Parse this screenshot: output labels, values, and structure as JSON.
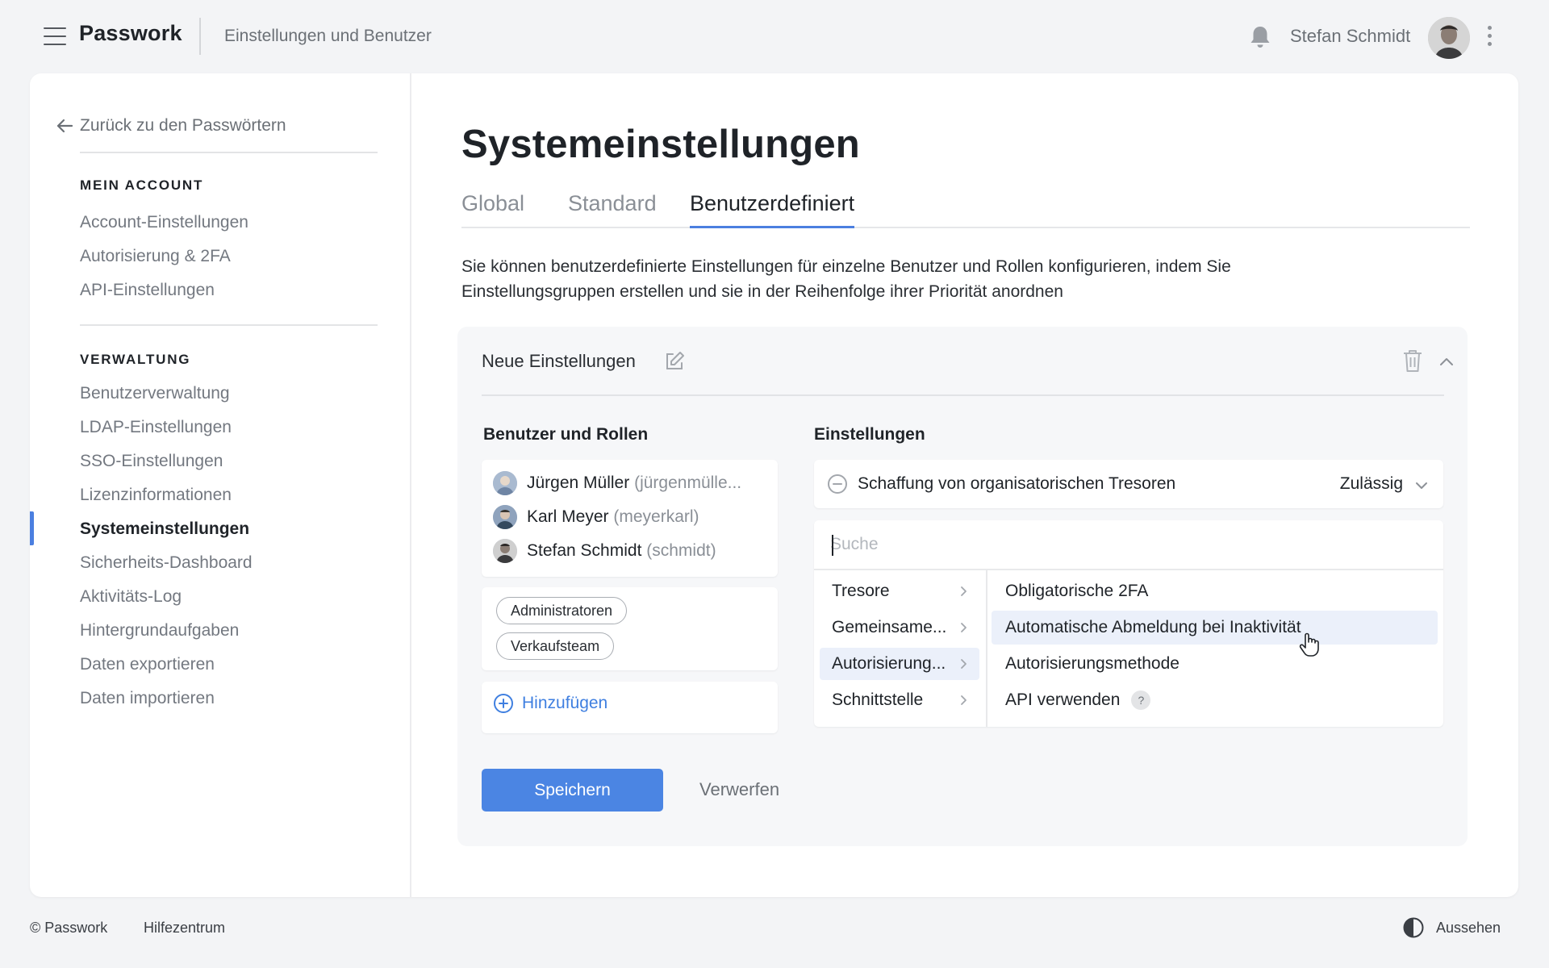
{
  "topbar": {
    "brand": "Passwork",
    "subtitle": "Einstellungen und Benutzer",
    "username": "Stefan Schmidt"
  },
  "sidebar": {
    "back_label": "Zurück zu den Passwörtern",
    "section_account": "MEIN ACCOUNT",
    "account_items": [
      "Account-Einstellungen",
      "Autorisierung & 2FA",
      "API-Einstellungen"
    ],
    "section_admin": "VERWALTUNG",
    "admin_items": [
      "Benutzerverwaltung",
      "LDAP-Einstellungen",
      "SSO-Einstellungen",
      "Lizenzinformationen",
      "Systemeinstellungen",
      "Sicherheits-Dashboard",
      "Aktivitäts-Log",
      "Hintergrundaufgaben",
      "Daten exportieren",
      "Daten importieren"
    ],
    "active_item": "Systemeinstellungen"
  },
  "main": {
    "title": "Systemeinstellungen",
    "tabs": [
      "Global",
      "Standard",
      "Benutzerdefiniert"
    ],
    "active_tab": "Benutzerdefiniert",
    "description": "Sie können benutzerdefinierte Einstellungen für einzelne Benutzer und Rollen konfigurieren, indem Sie Einstellungsgruppen erstellen und sie in der Reihenfolge ihrer Priorität anordnen"
  },
  "panel": {
    "name": "Neue Einstellungen",
    "users_label": "Benutzer und Rollen",
    "users": [
      {
        "name": "Jürgen Müller",
        "login": "(jürgenmülle..."
      },
      {
        "name": "Karl Meyer",
        "login": "(meyerkarl)"
      },
      {
        "name": "Stefan Schmidt",
        "login": "(schmidt)"
      }
    ],
    "roles": [
      "Administratoren",
      "Verkaufsteam"
    ],
    "add_label": "Hinzufügen",
    "settings_label": "Einstellungen",
    "setting": {
      "label": "Schaffung von organisatorischen Tresoren",
      "value": "Zulässig"
    },
    "search_placeholder": "Suche",
    "categories": [
      "Tresore",
      "Gemeinsame...",
      "Autorisierung...",
      "Schnittstelle"
    ],
    "active_category": "Autorisierung...",
    "options": [
      "Obligatorische 2FA",
      "Automatische Abmeldung bei Inaktivität",
      "Autorisierungsmethode",
      "API verwenden"
    ],
    "hovered_option": "Automatische Abmeldung bei Inaktivität",
    "help_badge": "?",
    "save_label": "Speichern",
    "discard_label": "Verwerfen"
  },
  "footer": {
    "copyright": "© Passwork",
    "help": "Hilfezentrum",
    "appearance": "Aussehen"
  },
  "colors": {
    "accent": "#4b85e3",
    "link": "#3f7fe0",
    "highlight": "#ebf0fa"
  }
}
